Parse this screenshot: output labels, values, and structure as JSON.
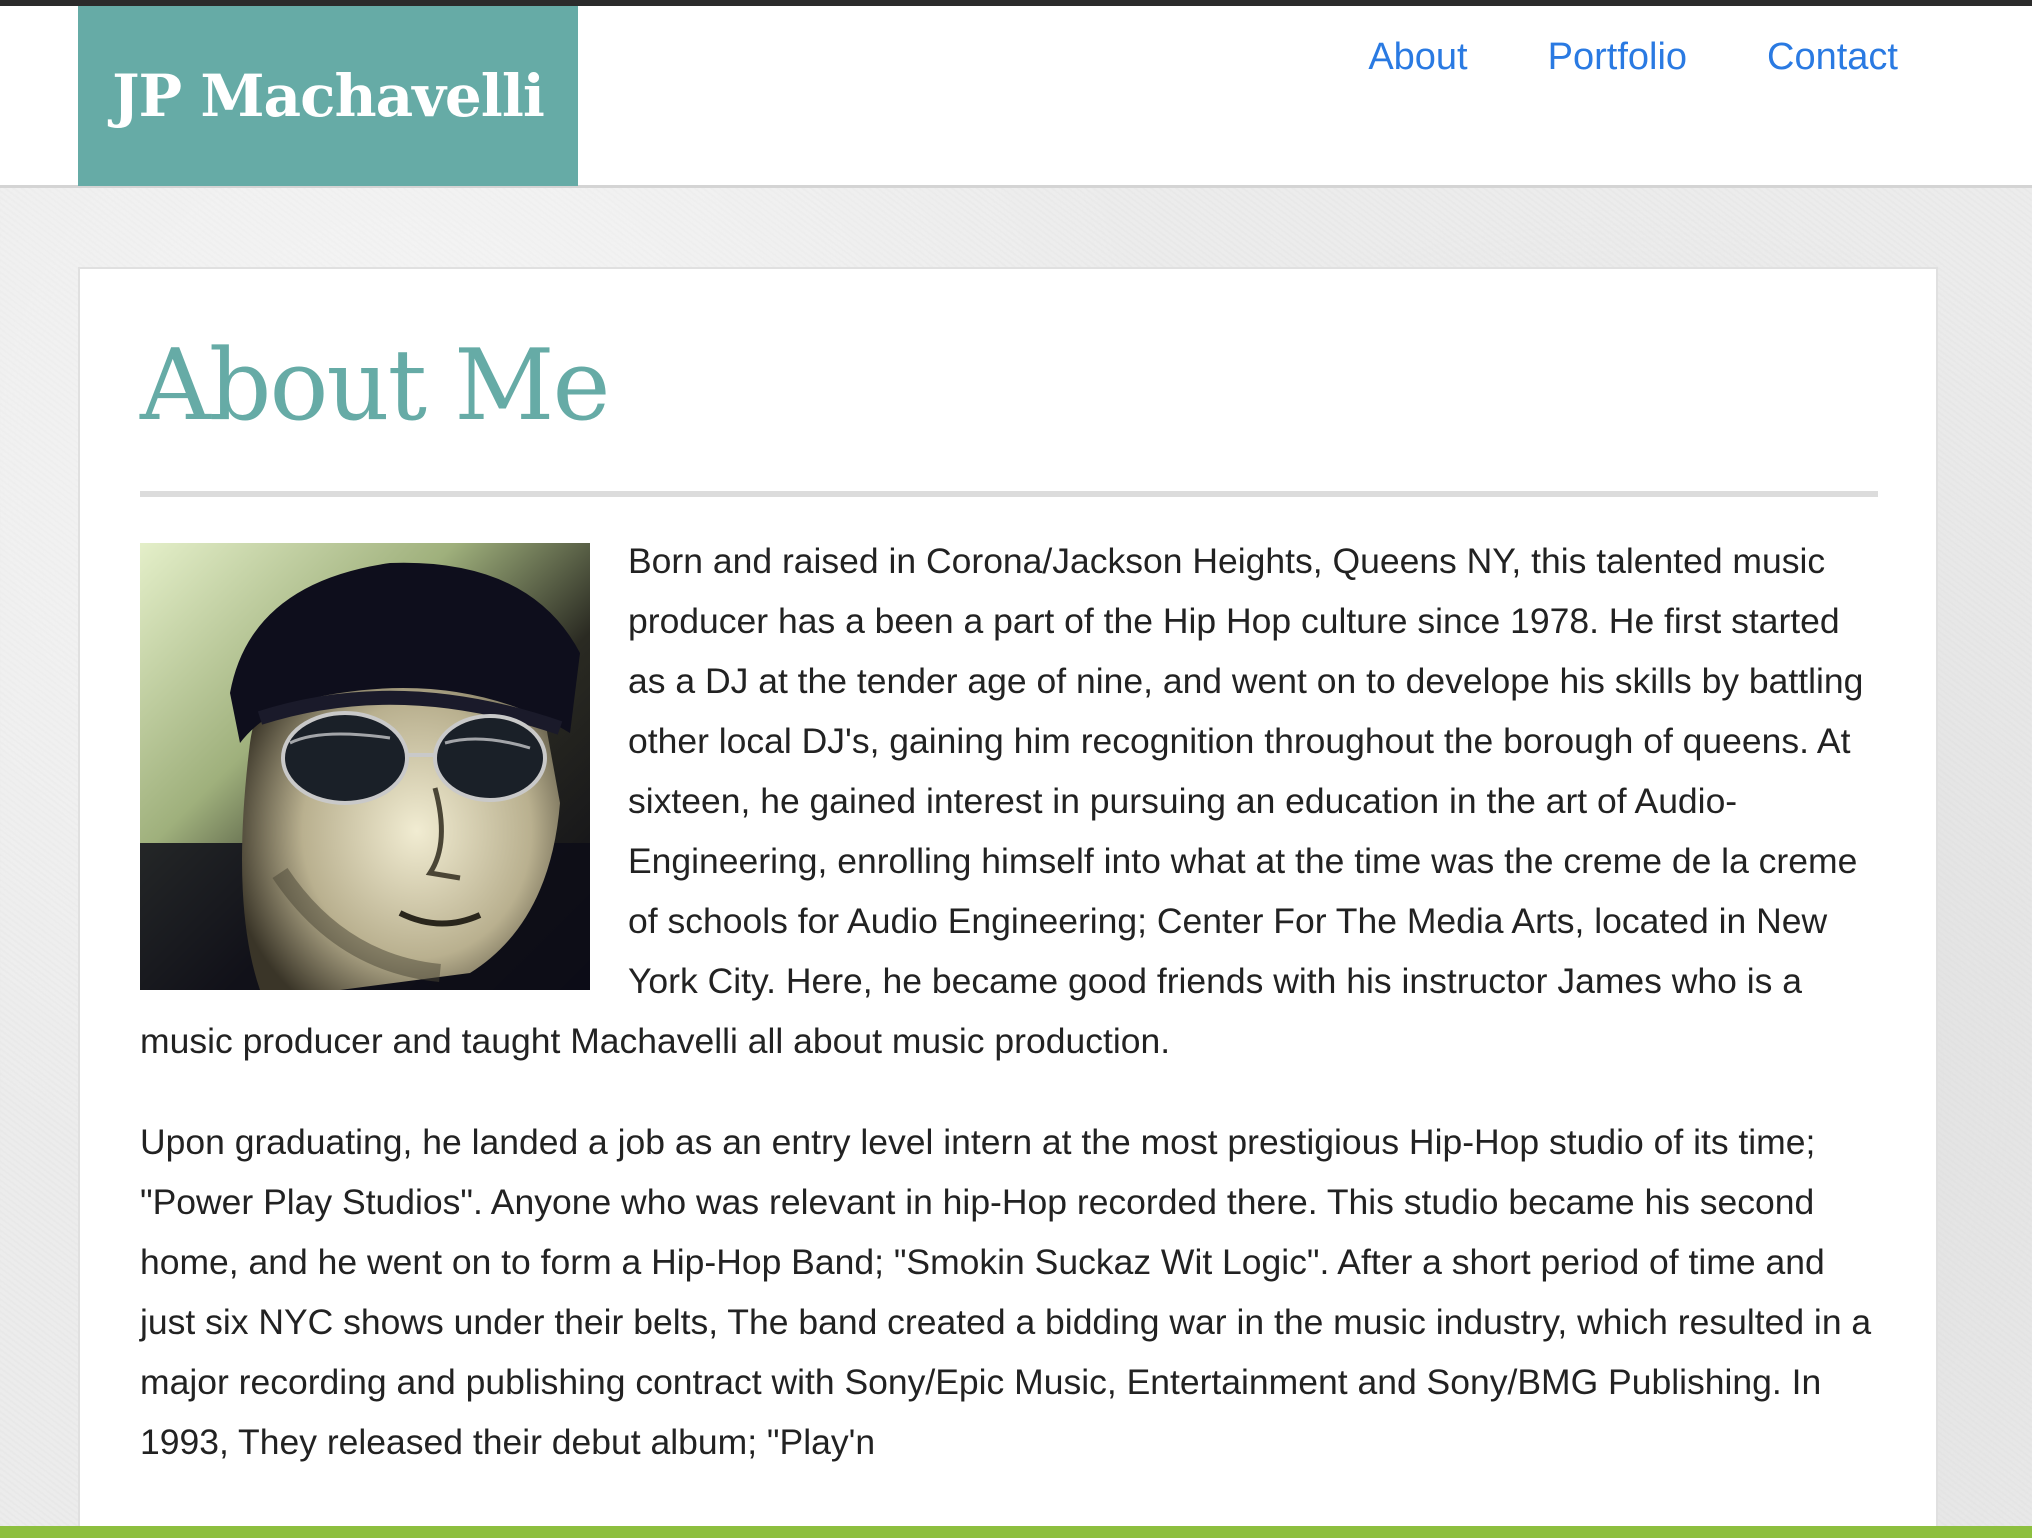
{
  "site": {
    "name": "JP Machavelli"
  },
  "nav": {
    "items": [
      {
        "label": "About"
      },
      {
        "label": "Portfolio"
      },
      {
        "label": "Contact"
      }
    ]
  },
  "main": {
    "title": "About Me",
    "paragraphs": [
      "Born and raised in Corona/Jackson Heights, Queens NY, this talented music producer has a been a part of the Hip Hop culture since 1978. He first started as a DJ at the tender age of nine, and went on to develope his skills by battling other local DJ's, gaining him recognition throughout the borough of queens. At sixteen, he gained interest in pursuing an education in the art of Audio-Engineering, enrolling himself into what at the time was the creme de la creme of schools for Audio Engineering; Center For The Media Arts, located in New York City. Here, he became good friends with his instructor James who is a music producer and taught Machavelli all about music production.",
      "Upon graduating, he landed a job as an entry level intern at the most prestigious Hip-Hop studio of its time; \"Power Play Studios\". Anyone who was relevant in hip-Hop recorded there. This studio became his second home, and he went on to form a Hip-Hop Band; \"Smokin Suckaz Wit Logic\". After a short period of time and just six NYC shows under their belts, The band created a bidding war in the music industry, which resulted in a major recording and publishing contract with Sony/Epic Music, Entertainment and Sony/BMG Publishing. In 1993, They released their debut album; \"Play'n"
    ]
  },
  "colors": {
    "accent": "#66aba6",
    "link": "#2a7ae2",
    "footer_bar": "#8dbf3f"
  }
}
